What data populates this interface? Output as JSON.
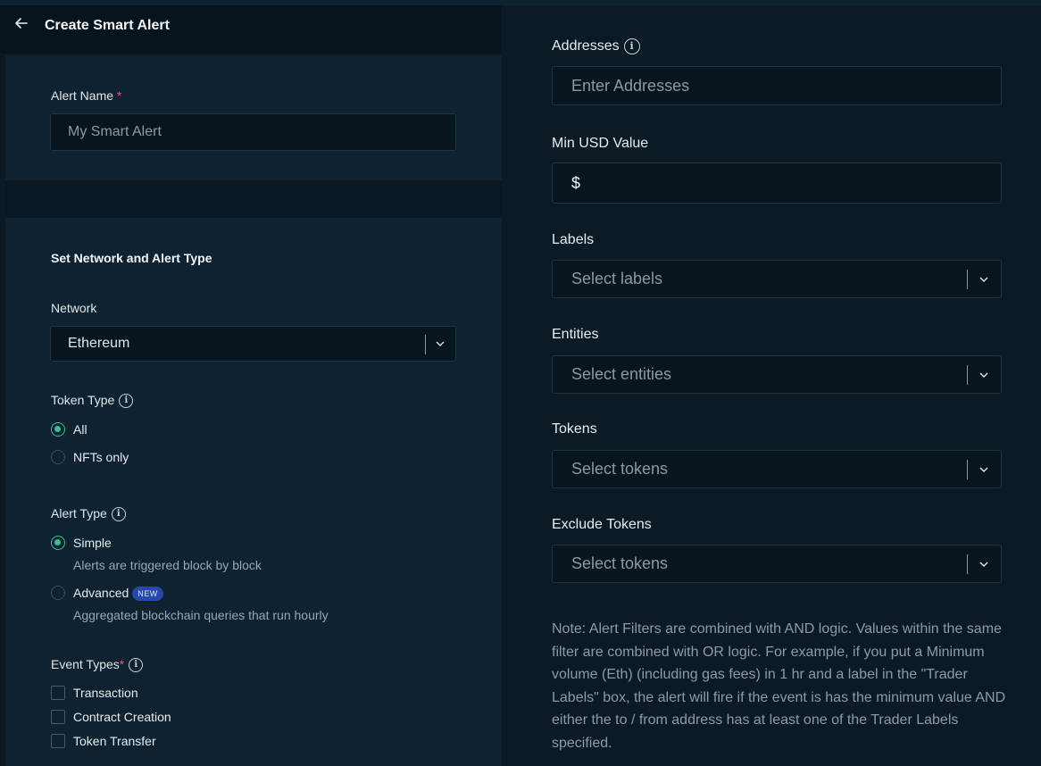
{
  "header": {
    "title": "Create Smart Alert",
    "back_icon": "arrow-left-icon"
  },
  "alert_name": {
    "label": "Alert Name",
    "required_mark": "*",
    "placeholder": "My Smart Alert"
  },
  "network_section": {
    "title": "Set Network and Alert Type",
    "network": {
      "label": "Network",
      "value": "Ethereum"
    },
    "token_type": {
      "label": "Token Type",
      "options": [
        {
          "label": "All",
          "selected": true
        },
        {
          "label": "NFTs only",
          "selected": false
        }
      ]
    },
    "alert_type": {
      "label": "Alert Type",
      "options": [
        {
          "label": "Simple",
          "description": "Alerts are triggered block by block",
          "selected": true
        },
        {
          "label": "Advanced",
          "badge": "NEW",
          "description": "Aggregated blockchain queries that run hourly",
          "selected": false
        }
      ]
    },
    "event_types": {
      "label": "Event Types",
      "required_mark": "*",
      "options": [
        {
          "label": "Transaction",
          "checked": false
        },
        {
          "label": "Contract Creation",
          "checked": false
        },
        {
          "label": "Token Transfer",
          "checked": false
        }
      ]
    }
  },
  "filters": {
    "addresses": {
      "label": "Addresses",
      "placeholder": "Enter Addresses"
    },
    "min_usd": {
      "label": "Min USD Value",
      "prefix": "$"
    },
    "labels": {
      "label": "Labels",
      "placeholder": "Select labels"
    },
    "entities": {
      "label": "Entities",
      "placeholder": "Select entities"
    },
    "tokens": {
      "label": "Tokens",
      "placeholder": "Select tokens"
    },
    "exclude_tokens": {
      "label": "Exclude Tokens",
      "placeholder": "Select tokens"
    }
  },
  "note": "Note: Alert Filters are combined with AND logic. Values within the same filter are combined with OR logic. For example, if you put a Minimum volume (Eth) (including gas fees) in 1 hr and a label in the \"Trader Labels\" box, the alert will fire if the event is has the minimum value AND either the to / from address has at least one of the Trader Labels specified.",
  "colors": {
    "accent": "#36c28f",
    "required": "#ef5b6c",
    "badge": "#2648a8",
    "background": "#0b1a24"
  }
}
